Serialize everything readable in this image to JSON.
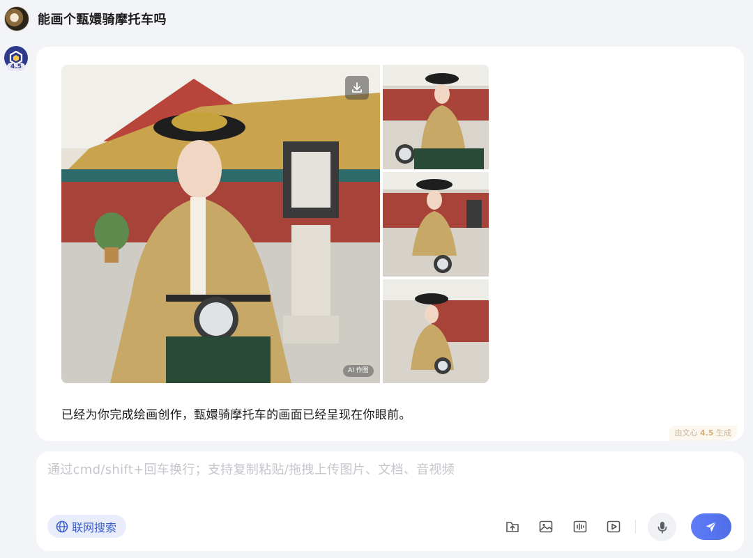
{
  "user_message": {
    "text": "能画个甄嬛骑摩托车吗"
  },
  "bot": {
    "badge": "4.5",
    "answer_text": "已经为你完成绘画创作，甄嬛骑摩托车的画面已经呈现在你眼前。",
    "ai_tag": "AI 作图",
    "source_prefix": "由文心",
    "source_version": "4.5",
    "source_suffix": "生成"
  },
  "images": {
    "main": "generated-image-1",
    "thumbs": [
      "generated-image-2",
      "generated-image-3",
      "generated-image-4"
    ]
  },
  "input": {
    "placeholder": "通过cmd/shift+回车换行；支持复制粘贴/拖拽上传图片、文档、音视频",
    "search_toggle_label": "联网搜索"
  },
  "icons": {
    "download": "download-icon",
    "globe": "globe-icon",
    "upload_file": "upload-file-icon",
    "image": "image-icon",
    "audio": "audio-icon",
    "video": "video-icon",
    "mic": "microphone-icon",
    "send": "send-icon"
  },
  "colors": {
    "accent": "#4f6ee8",
    "toggle_bg": "#e9edfb",
    "page_bg": "#f3f4f8"
  }
}
